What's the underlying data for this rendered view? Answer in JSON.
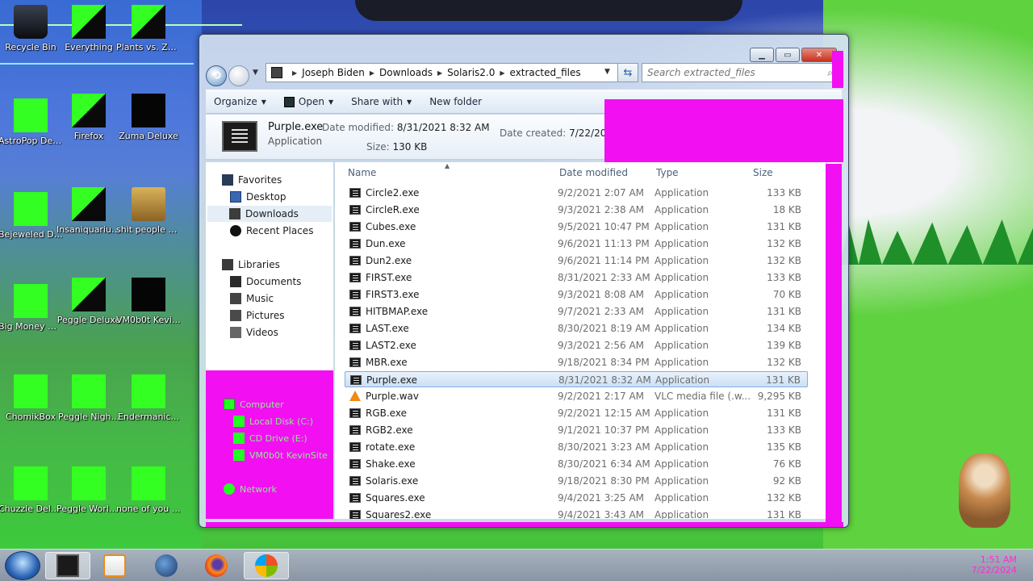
{
  "desktop": {
    "icons": [
      {
        "id": "recycle-bin",
        "label": "Recycle Bin"
      },
      {
        "id": "everything",
        "label": "Everything"
      },
      {
        "id": "plants-vs-zombies",
        "label": "Plants vs. Zombies"
      },
      {
        "id": "astropop",
        "label": "AstroPop Deluxe"
      },
      {
        "id": "firefox",
        "label": "Firefox"
      },
      {
        "id": "zuma",
        "label": "Zuma Deluxe"
      },
      {
        "id": "bejeweled",
        "label": "Bejeweled Deluxe"
      },
      {
        "id": "insaniquarium",
        "label": "Insaniquarium Deluxe"
      },
      {
        "id": "folder-people",
        "label": "shit people asked me ..."
      },
      {
        "id": "big-money",
        "label": "Big Money Deluxe"
      },
      {
        "id": "peggle",
        "label": "Peggle Deluxe"
      },
      {
        "id": "vm0b0t",
        "label": "VM0b0t KevinSite"
      },
      {
        "id": "chomikbox",
        "label": "ChomikBox"
      },
      {
        "id": "peggle-nights",
        "label": "Peggle Nigh..."
      },
      {
        "id": "endermanic",
        "label": "Endermanic..."
      },
      {
        "id": "chuzzle",
        "label": "Chuzzle Deluxe"
      },
      {
        "id": "peggle-world",
        "label": "Peggle World of Warcraft ..."
      },
      {
        "id": "none-of-you",
        "label": "none of you retards kno..."
      }
    ]
  },
  "window": {
    "controls": {
      "minimize": "▁",
      "maximize": "▭",
      "close": "✕"
    },
    "breadcrumb": [
      "Joseph Biden",
      "Downloads",
      "Solaris2.0",
      "extracted_files"
    ],
    "search_placeholder": "Search extracted_files",
    "toolbar": {
      "organize": "Organize",
      "open": "Open",
      "share_with": "Share with",
      "new_folder": "New folder"
    },
    "details": {
      "name": "Purple.exe",
      "type": "Application",
      "modified_label": "Date modified:",
      "modified_value": "8/31/2021 8:32 AM",
      "size_label": "Size:",
      "size_value": "130 KB",
      "created_label": "Date created:",
      "created_value": "7/22/2024 1:50 AM"
    },
    "nav": {
      "favorites": "Favorites",
      "desktop": "Desktop",
      "downloads": "Downloads",
      "recent_places": "Recent Places",
      "libraries": "Libraries",
      "documents": "Documents",
      "music": "Music",
      "pictures": "Pictures",
      "videos": "Videos",
      "computer": "Computer",
      "local_disk": "Local Disk (C:)",
      "cd_drive": "CD Drive (E:)",
      "vm_share": "VM0b0t KevinSite",
      "network": "Network"
    },
    "columns": {
      "name": "Name",
      "date_modified": "Date modified",
      "type": "Type",
      "size": "Size"
    },
    "files": [
      {
        "name": "Circle2.exe",
        "date": "9/2/2021 2:07 AM",
        "type": "Application",
        "size": "133 KB",
        "icon": "exe-icon"
      },
      {
        "name": "CircleR.exe",
        "date": "9/3/2021 2:38 AM",
        "type": "Application",
        "size": "18 KB",
        "icon": "exe-icon"
      },
      {
        "name": "Cubes.exe",
        "date": "9/5/2021 10:47 PM",
        "type": "Application",
        "size": "131 KB",
        "icon": "exe-icon"
      },
      {
        "name": "Dun.exe",
        "date": "9/6/2021 11:13 PM",
        "type": "Application",
        "size": "132 KB",
        "icon": "exe-icon"
      },
      {
        "name": "Dun2.exe",
        "date": "9/6/2021 11:14 PM",
        "type": "Application",
        "size": "132 KB",
        "icon": "exe-icon"
      },
      {
        "name": "FIRST.exe",
        "date": "8/31/2021 2:33 AM",
        "type": "Application",
        "size": "133 KB",
        "icon": "exe-icon"
      },
      {
        "name": "FIRST3.exe",
        "date": "9/3/2021 8:08 AM",
        "type": "Application",
        "size": "70 KB",
        "icon": "exe-icon"
      },
      {
        "name": "HITBMAP.exe",
        "date": "9/7/2021 2:33 AM",
        "type": "Application",
        "size": "131 KB",
        "icon": "exe-icon"
      },
      {
        "name": "LAST.exe",
        "date": "8/30/2021 8:19 AM",
        "type": "Application",
        "size": "134 KB",
        "icon": "exe-icon"
      },
      {
        "name": "LAST2.exe",
        "date": "9/3/2021 2:56 AM",
        "type": "Application",
        "size": "139 KB",
        "icon": "exe-icon"
      },
      {
        "name": "MBR.exe",
        "date": "9/18/2021 8:34 PM",
        "type": "Application",
        "size": "132 KB",
        "icon": "exe-icon"
      },
      {
        "name": "Purple.exe",
        "date": "8/31/2021 8:32 AM",
        "type": "Application",
        "size": "131 KB",
        "icon": "exe-icon",
        "selected": true
      },
      {
        "name": "Purple.wav",
        "date": "9/2/2021 2:17 AM",
        "type": "VLC media file (.w...",
        "size": "9,295 KB",
        "icon": "vlc-icon"
      },
      {
        "name": "RGB.exe",
        "date": "9/2/2021 12:15 AM",
        "type": "Application",
        "size": "131 KB",
        "icon": "exe-icon"
      },
      {
        "name": "RGB2.exe",
        "date": "9/1/2021 10:37 PM",
        "type": "Application",
        "size": "133 KB",
        "icon": "exe-icon"
      },
      {
        "name": "rotate.exe",
        "date": "8/30/2021 3:23 AM",
        "type": "Application",
        "size": "135 KB",
        "icon": "exe-icon"
      },
      {
        "name": "Shake.exe",
        "date": "8/30/2021 6:34 AM",
        "type": "Application",
        "size": "76 KB",
        "icon": "exe-icon"
      },
      {
        "name": "Solaris.exe",
        "date": "9/18/2021 8:30 PM",
        "type": "Application",
        "size": "92 KB",
        "icon": "exe-icon"
      },
      {
        "name": "Squares.exe",
        "date": "9/4/2021 3:25 AM",
        "type": "Application",
        "size": "132 KB",
        "icon": "exe-icon"
      },
      {
        "name": "Squares2.exe",
        "date": "9/4/2021 3:43 AM",
        "type": "Application",
        "size": "131 KB",
        "icon": "exe-icon"
      }
    ]
  },
  "taskbar": {
    "items": [
      "explorer-icon",
      "media-player-icon",
      "globe-icon",
      "firefox-icon",
      "windows-logo-icon"
    ],
    "clock_time": "1:51 AM",
    "clock_date": "7/22/2024"
  },
  "colors": {
    "glitch_magenta": "#f20ff2",
    "glitch_green": "#33ff22",
    "selection": "#cde0f5"
  }
}
